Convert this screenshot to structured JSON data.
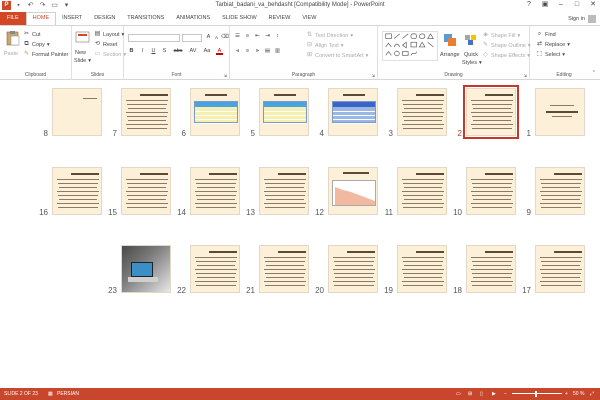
{
  "app": {
    "title": "Tarbiat_badani_va_behdasht [Compatibility Mode] - PowerPoint",
    "logo_letter": "P",
    "signin": "Sign in"
  },
  "tabs": [
    "FILE",
    "HOME",
    "INSERT",
    "DESIGN",
    "TRANSITIONS",
    "ANIMATIONS",
    "SLIDE SHOW",
    "REVIEW",
    "VIEW"
  ],
  "active_tab": "HOME",
  "ribbon": {
    "clipboard": {
      "paste": "Paste",
      "cut": "Cut",
      "copy": "Copy",
      "format_painter": "Format Painter",
      "label": "Clipboard"
    },
    "slides": {
      "new_slide": "New",
      "new_slide2": "Slide",
      "layout": "Layout",
      "reset": "Reset",
      "section": "Section",
      "label": "Slides"
    },
    "font": {
      "label": "Font",
      "buttons": [
        "B",
        "I",
        "U",
        "S",
        "abc",
        "AV",
        "Aa",
        "A"
      ]
    },
    "paragraph": {
      "label": "Paragraph",
      "text_direction": "Text Direction",
      "align_text": "Align Text",
      "convert_smartart": "Convert to SmartArt"
    },
    "drawing": {
      "label": "Drawing",
      "arrange": "Arrange",
      "quick_styles": "Quick",
      "quick_styles2": "Styles",
      "shape_fill": "Shape Fill",
      "shape_outline": "Shape Outline",
      "shape_effects": "Shape Effects"
    },
    "editing": {
      "label": "Editing",
      "find": "Find",
      "replace": "Replace",
      "select": "Select"
    }
  },
  "slides": [
    {
      "num": "1",
      "kind": "title"
    },
    {
      "num": "2",
      "kind": "text",
      "selected": true
    },
    {
      "num": "3",
      "kind": "text"
    },
    {
      "num": "4",
      "kind": "table-blue"
    },
    {
      "num": "5",
      "kind": "table-yellow"
    },
    {
      "num": "6",
      "kind": "table-yellow"
    },
    {
      "num": "7",
      "kind": "text"
    },
    {
      "num": "8",
      "kind": "title-small"
    },
    {
      "num": "9",
      "kind": "text"
    },
    {
      "num": "10",
      "kind": "text"
    },
    {
      "num": "11",
      "kind": "text"
    },
    {
      "num": "12",
      "kind": "chart"
    },
    {
      "num": "13",
      "kind": "text"
    },
    {
      "num": "14",
      "kind": "text"
    },
    {
      "num": "15",
      "kind": "text"
    },
    {
      "num": "16",
      "kind": "text"
    },
    {
      "num": "17",
      "kind": "text"
    },
    {
      "num": "18",
      "kind": "text"
    },
    {
      "num": "19",
      "kind": "text"
    },
    {
      "num": "20",
      "kind": "text"
    },
    {
      "num": "21",
      "kind": "text"
    },
    {
      "num": "22",
      "kind": "text"
    },
    {
      "num": "23",
      "kind": "photo"
    }
  ],
  "status": {
    "slide_counter": "SLIDE 2 OF 23",
    "language": "PERSIAN",
    "zoom": "50 %"
  },
  "colors": {
    "accent": "#d24726",
    "status_bar": "#c8462b",
    "slide_bg": "#fdf0d8",
    "selected_outline": "#c0392b"
  }
}
